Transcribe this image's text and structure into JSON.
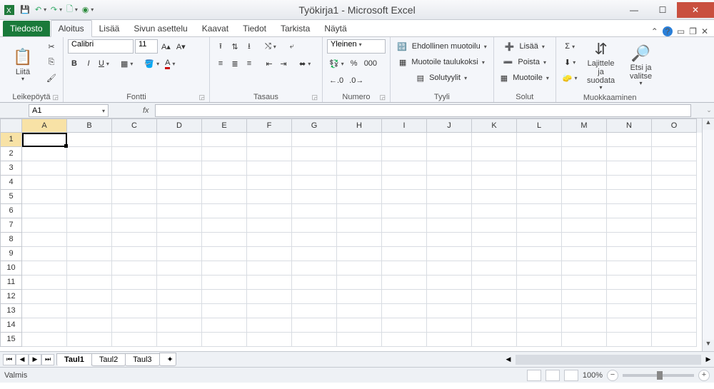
{
  "title": "Työkirja1 - Microsoft Excel",
  "tabs": {
    "file": "Tiedosto",
    "home": "Aloitus",
    "insert": "Lisää",
    "layout": "Sivun asettelu",
    "formulas": "Kaavat",
    "data": "Tiedot",
    "review": "Tarkista",
    "view": "Näytä"
  },
  "groups": {
    "clipboard": "Leikepöytä",
    "font": "Fontti",
    "align": "Tasaus",
    "number": "Numero",
    "styles": "Tyyli",
    "cells": "Solut",
    "editing": "Muokkaaminen"
  },
  "clipboard": {
    "paste": "Liitä"
  },
  "font": {
    "name": "Calibri",
    "size": "11"
  },
  "number": {
    "format": "Yleinen"
  },
  "styles": {
    "cond": "Ehdollinen muotoilu",
    "table": "Muotoile taulukoksi",
    "cell": "Solutyylit"
  },
  "cells": {
    "insert": "Lisää",
    "delete": "Poista",
    "format": "Muotoile"
  },
  "editing": {
    "sort": "Lajittele ja suodata",
    "find": "Etsi ja valitse"
  },
  "namebox": "A1",
  "cols": [
    "A",
    "B",
    "C",
    "D",
    "E",
    "F",
    "G",
    "H",
    "I",
    "J",
    "K",
    "L",
    "M",
    "N",
    "O"
  ],
  "rows": [
    "1",
    "2",
    "3",
    "4",
    "5",
    "6",
    "7",
    "8",
    "9",
    "10",
    "11",
    "12",
    "13",
    "14",
    "15"
  ],
  "sheets": {
    "s1": "Taul1",
    "s2": "Taul2",
    "s3": "Taul3"
  },
  "status": {
    "ready": "Valmis",
    "zoom": "100%"
  }
}
